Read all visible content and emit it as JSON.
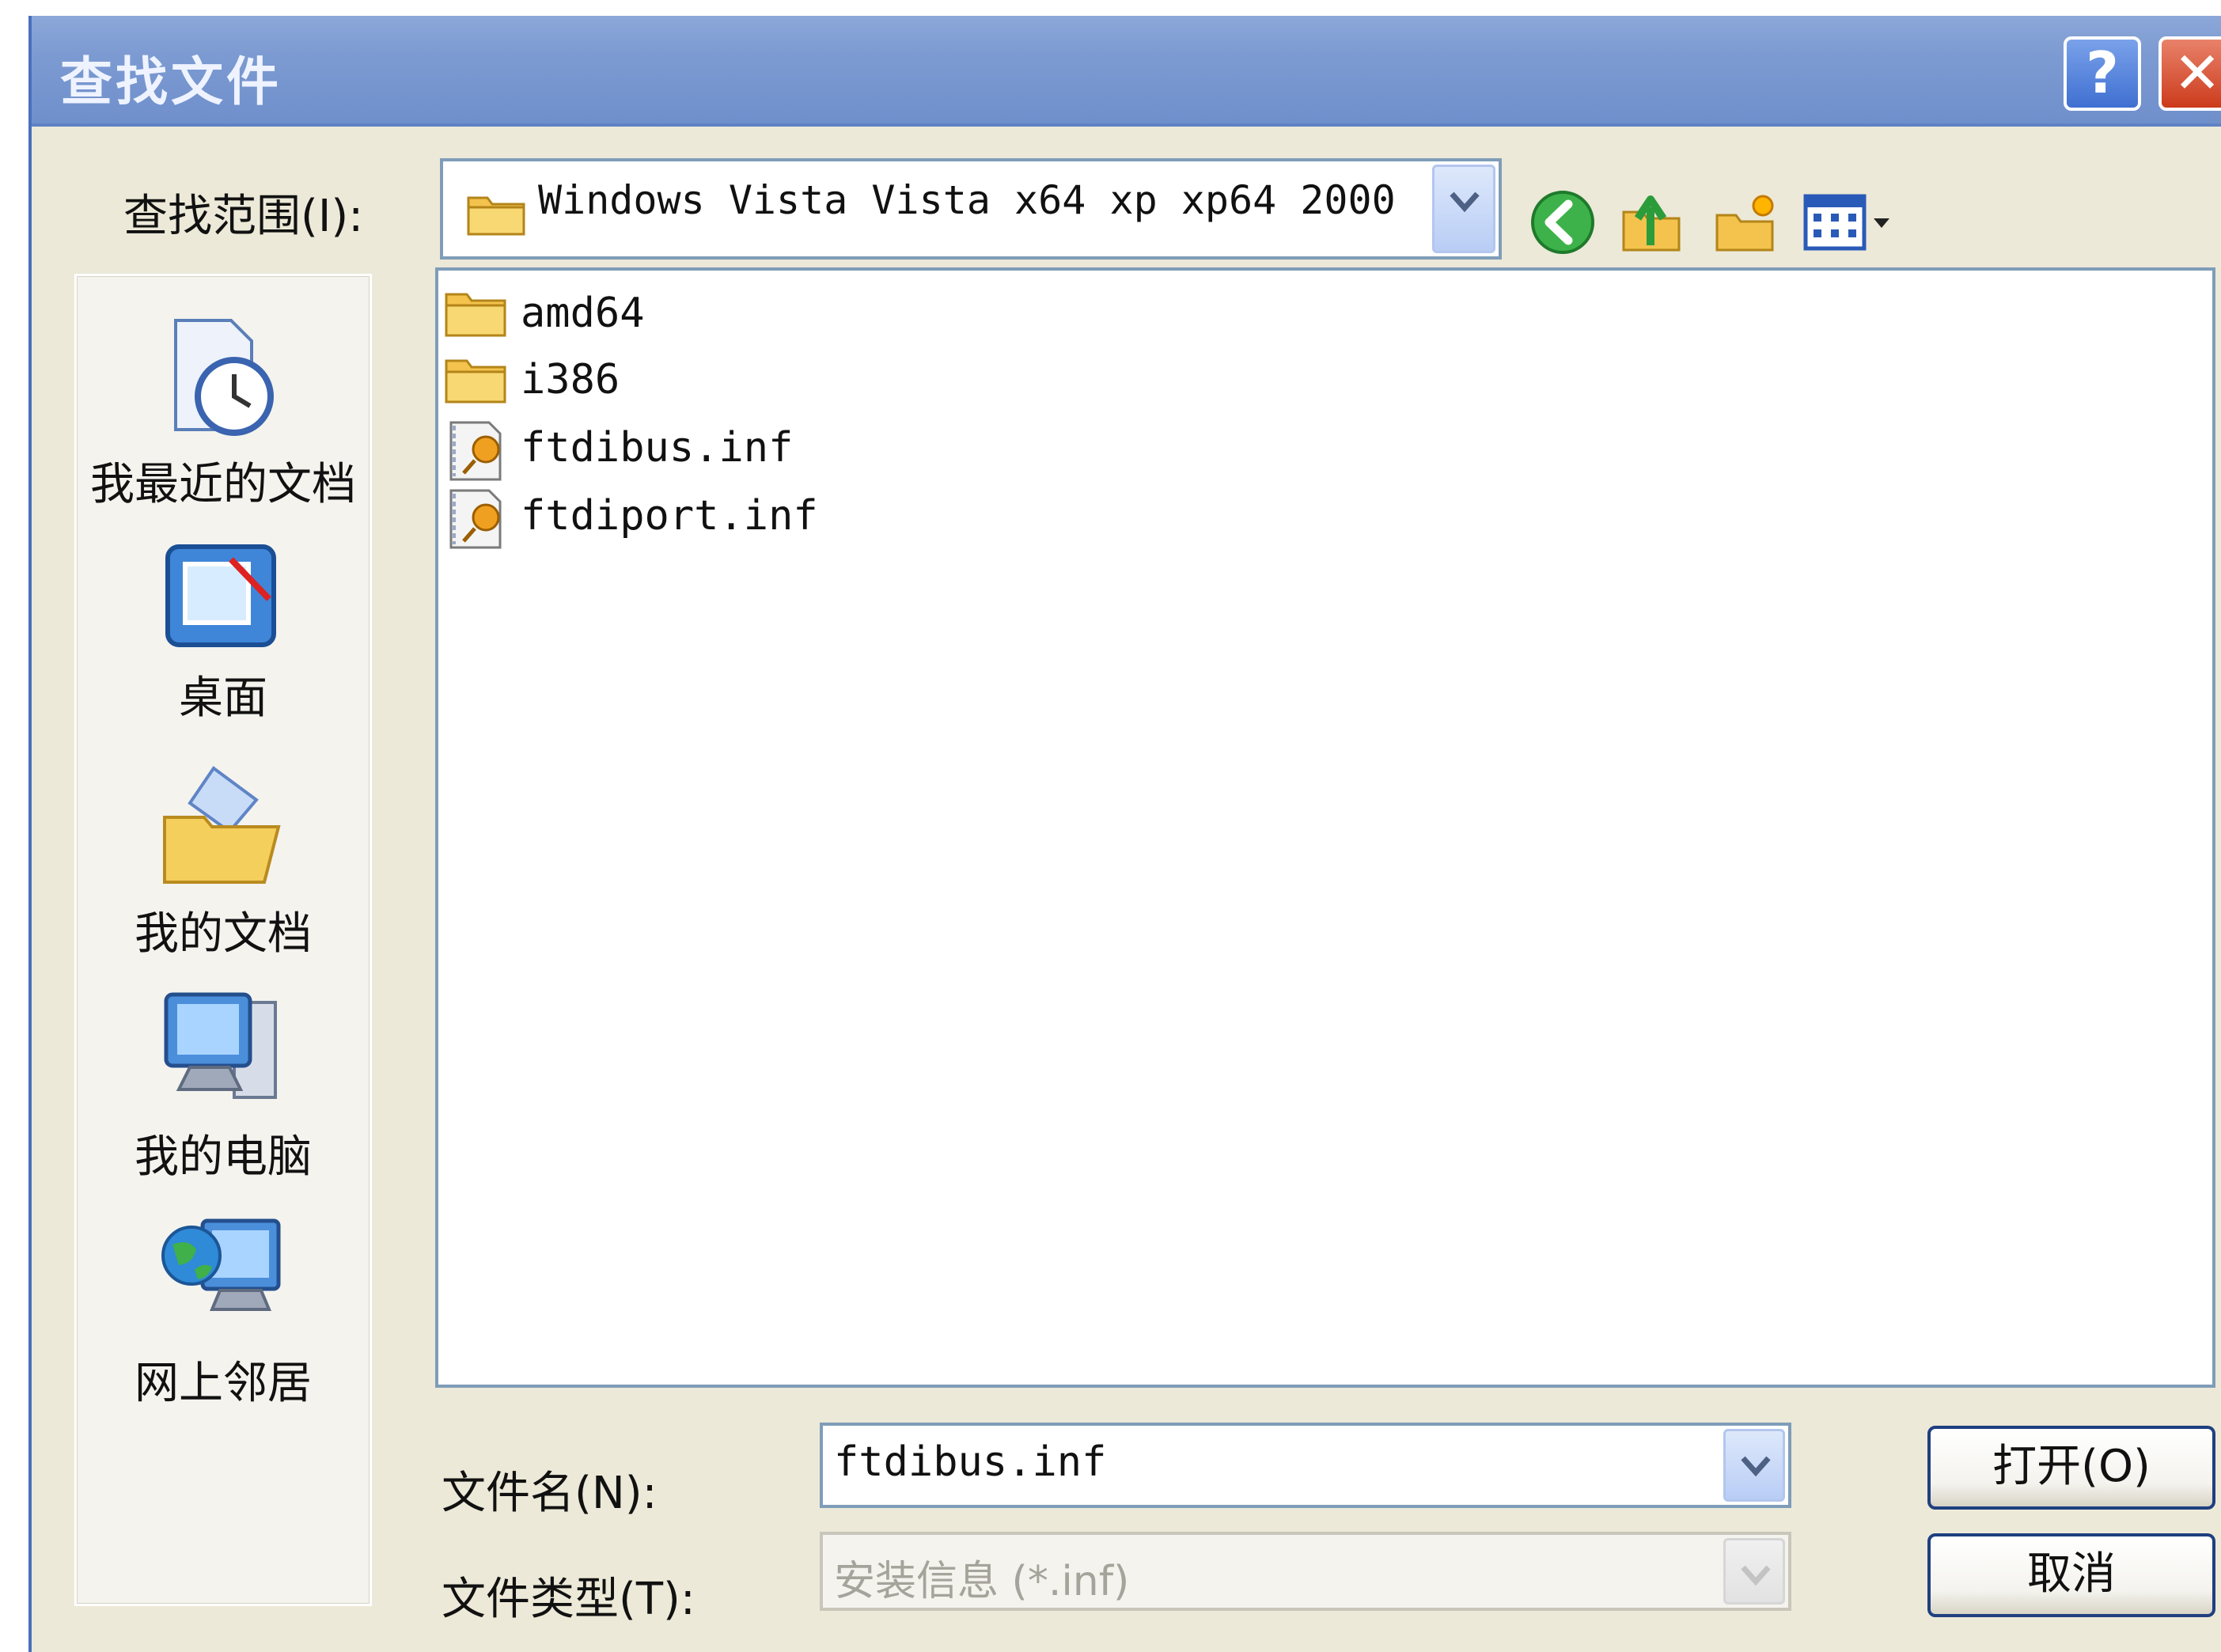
{
  "window": {
    "title": "查找文件",
    "help_glyph": "?",
    "close_glyph": "✕"
  },
  "lookin": {
    "label": "查找范围(I):",
    "value": "Windows Vista Vista x64 xp xp64 2000"
  },
  "toolbar": {
    "icons": [
      "back-icon",
      "up-folder-icon",
      "new-folder-icon",
      "view-menu-icon"
    ]
  },
  "places": [
    {
      "label": "我最近的文档",
      "icon": "recent-documents-icon"
    },
    {
      "label": "桌面",
      "icon": "desktop-icon"
    },
    {
      "label": "我的文档",
      "icon": "my-documents-icon"
    },
    {
      "label": "我的电脑",
      "icon": "my-computer-icon"
    },
    {
      "label": "网上邻居",
      "icon": "network-places-icon"
    }
  ],
  "files": [
    {
      "name": "amd64",
      "type": "folder"
    },
    {
      "name": "i386",
      "type": "folder"
    },
    {
      "name": "ftdibus.inf",
      "type": "inf"
    },
    {
      "name": "ftdiport.inf",
      "type": "inf"
    }
  ],
  "filename": {
    "label": "文件名(N):",
    "value": "ftdibus.inf"
  },
  "filetype": {
    "label": "文件类型(T):",
    "value": "安装信息 (*.inf)"
  },
  "buttons": {
    "open": "打开(O)",
    "cancel": "取消"
  },
  "colors": {
    "titlebar": "#7d9bd2",
    "dialog_bg": "#ece9d8",
    "field_border": "#7f9db9"
  }
}
